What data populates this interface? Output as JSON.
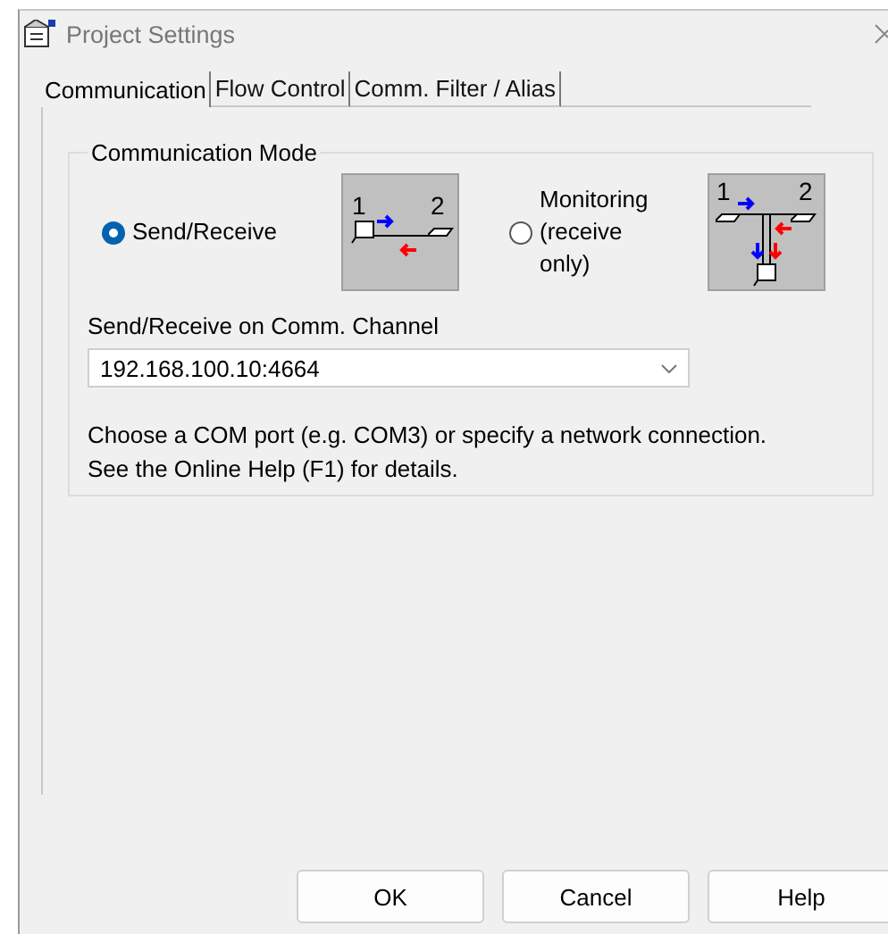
{
  "window": {
    "title": "Project Settings"
  },
  "tabs": [
    {
      "label": "Communication",
      "selected": true
    },
    {
      "label": "Flow Control",
      "selected": false
    },
    {
      "label": "Comm. Filter / Alias",
      "selected": false
    }
  ],
  "communication_mode": {
    "title": "Communication Mode",
    "options": [
      {
        "label": "Send/Receive",
        "selected": true,
        "kind": "point",
        "diagram_labels": [
          "1",
          "2"
        ]
      },
      {
        "label": "Monitoring (receive only)",
        "selected": false,
        "kind": "tap",
        "diagram_labels": [
          "1",
          "2"
        ]
      }
    ]
  },
  "channel": {
    "label": "Send/Receive on Comm. Channel",
    "value": "192.168.100.10:4664"
  },
  "help_text": [
    "Choose a COM port (e.g. COM3) or specify a network connection.",
    "See the Online Help (F1) for details."
  ],
  "buttons": [
    "OK",
    "Cancel",
    "Help"
  ]
}
